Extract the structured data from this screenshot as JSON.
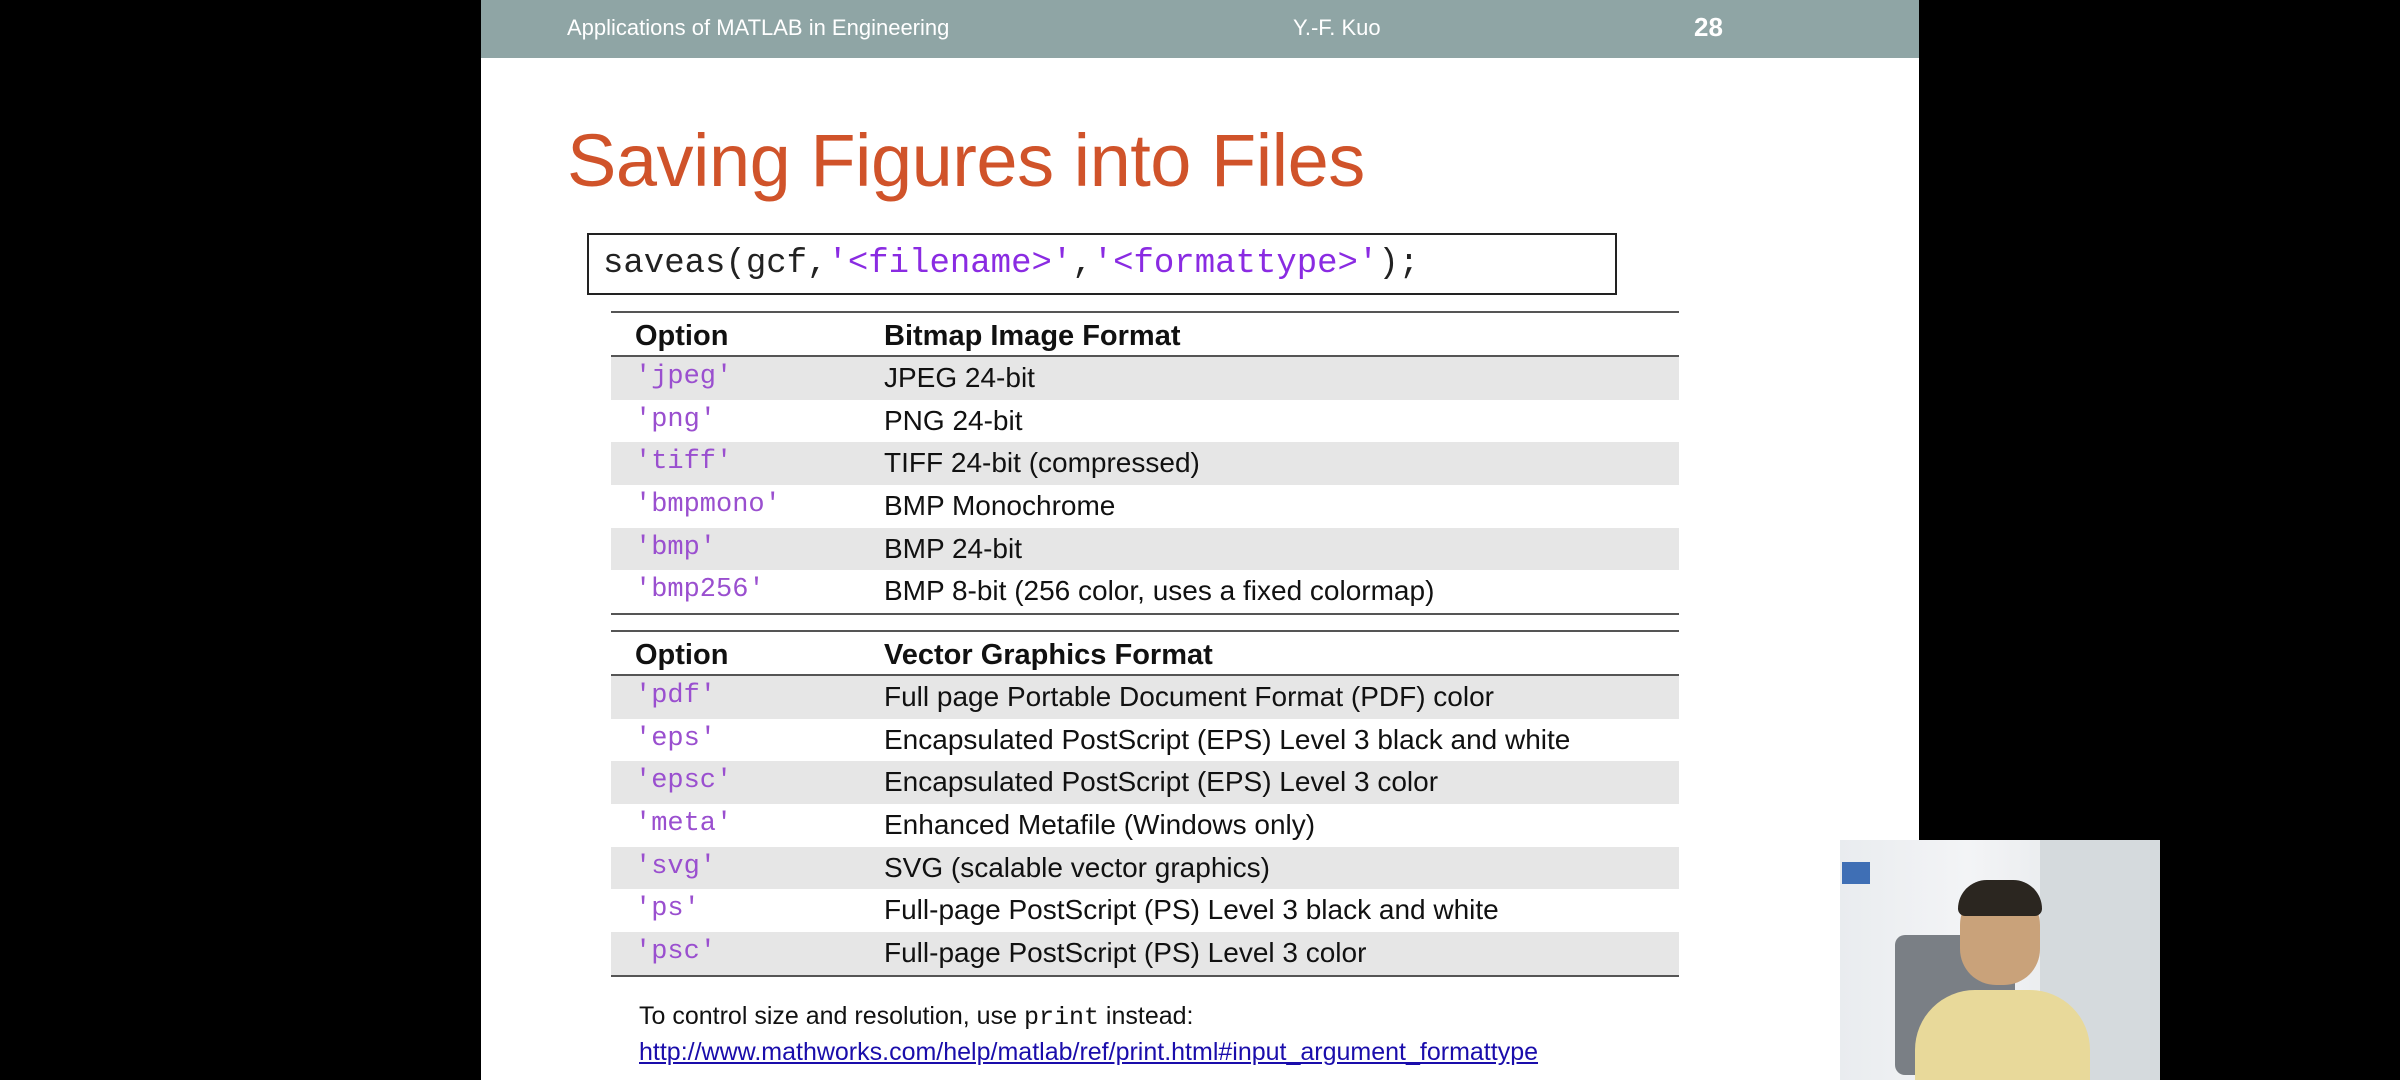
{
  "header": {
    "course": "Applications of MATLAB in Engineering",
    "author": "Y.-F. Kuo",
    "page": "28"
  },
  "title": "Saving Figures into Files",
  "code": {
    "prefix": "saveas(gcf,",
    "arg1": "'<filename>'",
    "sep": ",",
    "arg2": "'<formattype>'",
    "suffix": ");"
  },
  "bitmap_table": {
    "headers": [
      "Option",
      "Bitmap Image Format"
    ],
    "rows": [
      {
        "option": "'jpeg'",
        "format": "JPEG 24-bit"
      },
      {
        "option": "'png'",
        "format": "PNG 24-bit"
      },
      {
        "option": "'tiff'",
        "format": "TIFF 24-bit (compressed)"
      },
      {
        "option": "'bmpmono'",
        "format": "BMP Monochrome"
      },
      {
        "option": "'bmp'",
        "format": "BMP 24-bit"
      },
      {
        "option": "'bmp256'",
        "format": "BMP 8-bit (256 color, uses a fixed colormap)"
      }
    ]
  },
  "vector_table": {
    "headers": [
      "Option",
      "Vector Graphics Format"
    ],
    "rows": [
      {
        "option": "'pdf'",
        "format": "Full page Portable Document Format (PDF) color"
      },
      {
        "option": "'eps'",
        "format": "Encapsulated PostScript (EPS) Level 3 black and white"
      },
      {
        "option": "'epsc'",
        "format": "Encapsulated PostScript (EPS) Level 3 color"
      },
      {
        "option": "'meta'",
        "format": "Enhanced Metafile (Windows only)"
      },
      {
        "option": "'svg'",
        "format": "SVG (scalable vector graphics)"
      },
      {
        "option": "'ps'",
        "format": "Full-page PostScript (PS) Level 3 black and white"
      },
      {
        "option": "'psc'",
        "format": "Full-page PostScript (PS) Level 3 color"
      }
    ]
  },
  "note": {
    "prefix": "To control size and resolution, use",
    "code": "print",
    "suffix": "instead:",
    "link": "http://www.mathworks.com/help/matlab/ref/print.html#input_argument_formattype"
  },
  "colors": {
    "header_bg": "#8fa5a5",
    "title": "#d0532a",
    "code_string": "#8a2be2",
    "link": "#1a0dab"
  }
}
